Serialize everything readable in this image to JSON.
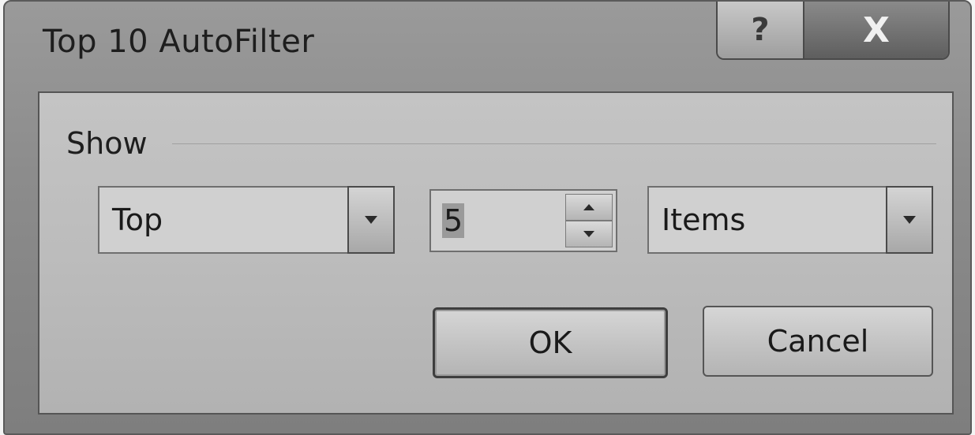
{
  "window": {
    "title": "Top 10 AutoFilter",
    "help_label": "?",
    "close_label": "X"
  },
  "group": {
    "label": "Show"
  },
  "controls": {
    "position_value": "Top",
    "count_value": "5",
    "unit_value": "Items"
  },
  "buttons": {
    "ok_label": "OK",
    "cancel_label": "Cancel"
  }
}
